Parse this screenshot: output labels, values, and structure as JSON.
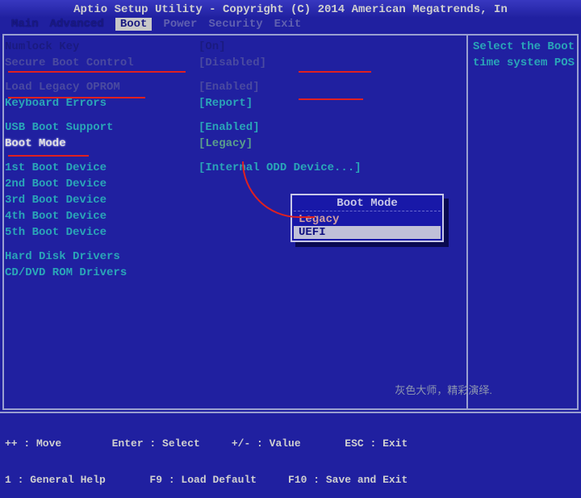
{
  "header": {
    "title": "Aptio Setup Utility - Copyright (C) 2014 American Megatrends, In"
  },
  "tabs": [
    "Main",
    "Advanced",
    "Boot",
    "Power",
    "Security",
    "Exit"
  ],
  "active_tab": 2,
  "settings": {
    "numlock": {
      "label": "Numlock Key",
      "value": "[On]"
    },
    "secure_boot": {
      "label": "Secure Boot Control",
      "value": "[Disabled]"
    },
    "legacy_oprom": {
      "label": "Load Legacy OPROM",
      "value": "[Enabled]"
    },
    "kbd_errors": {
      "label": "Keyboard Errors",
      "value": "[Report]"
    },
    "usb_boot": {
      "label": "USB Boot Support",
      "value": "[Enabled]"
    },
    "boot_mode": {
      "label": "Boot Mode",
      "value": "[Legacy]"
    },
    "boot1": {
      "label": "1st Boot Device",
      "value": "[Internal ODD Device...]"
    },
    "boot2": {
      "label": "2nd Boot Device",
      "value": ""
    },
    "boot3": {
      "label": "3rd Boot Device",
      "value": ""
    },
    "boot4": {
      "label": "4th Boot Device",
      "value": ""
    },
    "boot5": {
      "label": "5th Boot Device",
      "value": ""
    },
    "hdd_drv": {
      "label": "Hard Disk Drivers",
      "value": ""
    },
    "cd_drv": {
      "label": "CD/DVD ROM Drivers",
      "value": ""
    }
  },
  "popup": {
    "title": "Boot Mode",
    "options": [
      "Legacy",
      "UEFI"
    ],
    "selected": 1
  },
  "help": {
    "line1": "Select the Boot",
    "line2": "time system POS"
  },
  "footer": {
    "line1": "++ : Move        Enter : Select     +/- : Value       ESC : Exit",
    "line2": "1 : General Help       F9 : Load Default     F10 : Save and Exit"
  },
  "watermark": "灰色大师，精彩演绎."
}
